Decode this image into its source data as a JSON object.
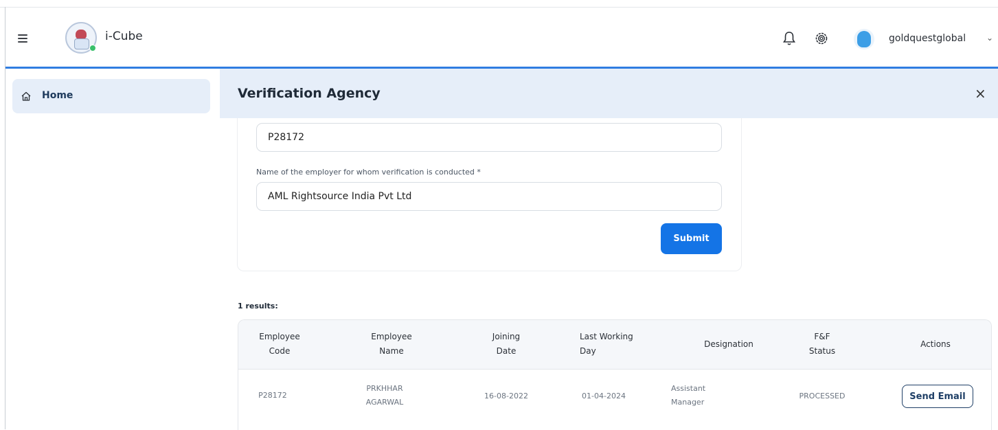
{
  "header": {
    "app_name": "i-Cube",
    "username": "goldquestglobal",
    "icons": [
      "menu-icon",
      "bell-icon",
      "gear-icon",
      "chevron-down-icon"
    ]
  },
  "sidebar": {
    "items": [
      {
        "label": "Home",
        "icon": "home-icon",
        "active": true
      }
    ]
  },
  "page": {
    "title": "Verification Agency",
    "close_glyph": "×"
  },
  "form": {
    "employee_code_value": "P28172",
    "employer_label": "Name of the employer for whom verification is conducted *",
    "employer_value": "AML Rightsource India Pvt Ltd",
    "submit_label": "Submit"
  },
  "results": {
    "summary": "1 results:",
    "columns": [
      [
        "Employee",
        "Code"
      ],
      [
        "Employee",
        "Name"
      ],
      [
        "Joining",
        "Date"
      ],
      [
        "Last Working",
        "Day"
      ],
      [
        "Designation"
      ],
      [
        "F&F",
        "Status"
      ],
      [
        "Actions"
      ]
    ],
    "rows": [
      {
        "employee_code": "P28172",
        "employee_name": [
          "PRKHHAR",
          "AGARWAL"
        ],
        "joining_date": "16-08-2022",
        "last_working_day": "01-04-2024",
        "designation": [
          "Assistant",
          "Manager"
        ],
        "ff_status": "PROCESSED",
        "action_label": "Send Email"
      }
    ]
  },
  "colors": {
    "accent": "#1474e6",
    "header_line": "#2f7de1",
    "banner_bg": "#e6eef9"
  }
}
